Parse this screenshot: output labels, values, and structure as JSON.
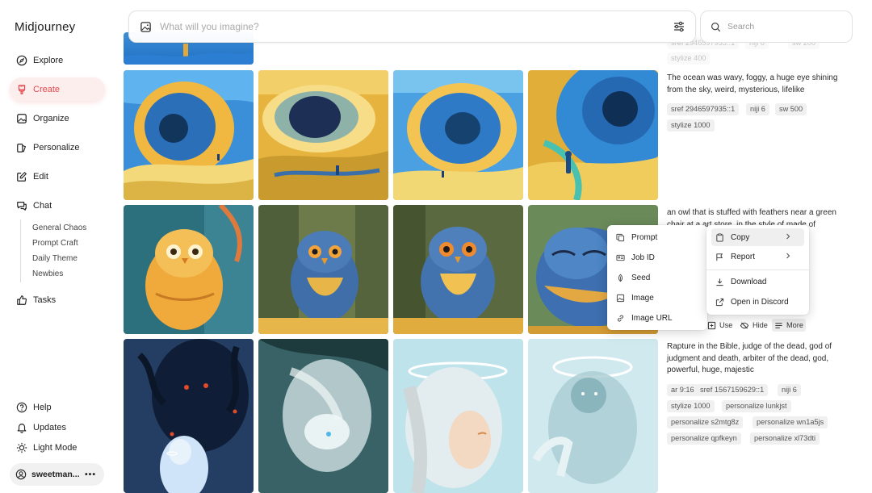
{
  "app": {
    "title": "Midjourney"
  },
  "sidebar": {
    "nav": [
      {
        "label": "Explore",
        "icon": "compass-icon"
      },
      {
        "label": "Create",
        "icon": "brush-icon",
        "active": true
      },
      {
        "label": "Organize",
        "icon": "image-icon"
      },
      {
        "label": "Personalize",
        "icon": "personalize-icon"
      },
      {
        "label": "Edit",
        "icon": "edit-icon"
      },
      {
        "label": "Chat",
        "icon": "chat-icon"
      }
    ],
    "chat_rooms": [
      "General Chaos",
      "Prompt Craft",
      "Daily Theme",
      "Newbies"
    ],
    "tasks": {
      "label": "Tasks",
      "icon": "thumbs-up-icon"
    },
    "bottom": [
      {
        "label": "Help",
        "icon": "help-icon"
      },
      {
        "label": "Updates",
        "icon": "bell-icon"
      },
      {
        "label": "Light Mode",
        "icon": "sun-icon"
      }
    ],
    "user": {
      "name": "sweetman...",
      "more": "•••"
    }
  },
  "topbar": {
    "imagine_placeholder": "What will you imagine?",
    "search_placeholder": "Search"
  },
  "job_top": {
    "chips": [
      "sref 2946597935::1",
      "niji 6",
      "sw 200",
      "stylize 400"
    ]
  },
  "jobs": [
    {
      "prompt": "The ocean was wavy, foggy, a huge eye shining from the sky, weird, mysterious, lifelike",
      "chips": [
        "sref 2946597935::1",
        "niji 6",
        "sw 500",
        "stylize 1000"
      ]
    },
    {
      "prompt": "an owl that is stuffed with feathers near a green chair at a art store, in the style of made of",
      "prompt_faded_line": "feathers",
      "chips": []
    },
    {
      "prompt": "Rapture in the Bible, judge of the dead, god of judgment and death, arbiter of the dead, god, powerful, huge, majestic",
      "chips": [
        "ar 9:16",
        "sref 1567159629::1",
        "niji 6",
        "stylize 1000",
        "personalize lunkjst",
        "personalize s2mtg8z",
        "personalize wn1a5js",
        "personalize qpfkeyn",
        "personalize xl73dti"
      ]
    }
  ],
  "actions": {
    "use": "Use",
    "hide": "Hide",
    "more": "More"
  },
  "more_menu": {
    "items": [
      "Copy",
      "Report",
      "Download",
      "Open in Discord"
    ]
  },
  "copy_submenu": {
    "items": [
      "Prompt",
      "Job ID",
      "Seed",
      "Image",
      "Image URL"
    ]
  },
  "colors": {
    "accent": "#e5484d",
    "active_bg": "#fdeeee"
  }
}
